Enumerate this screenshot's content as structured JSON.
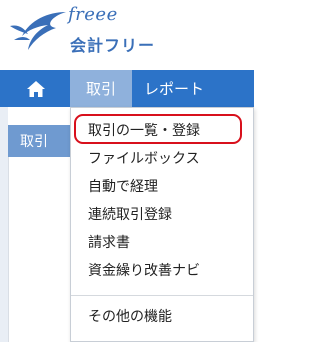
{
  "logo": {
    "brand": "freee",
    "product": "会計フリー"
  },
  "nav": {
    "home_icon": "home-icon",
    "tabs": [
      {
        "label": "取引",
        "active": true
      },
      {
        "label": "レポート",
        "active": false
      }
    ]
  },
  "page": {
    "sub_header_label": "取引"
  },
  "dropdown": {
    "items": [
      {
        "label": "取引の一覧・登録",
        "highlighted": true
      },
      {
        "label": "ファイルボックス"
      },
      {
        "label": "自動で経理"
      },
      {
        "label": "連続取引登録"
      },
      {
        "label": "請求書"
      },
      {
        "label": "資金繰り改善ナビ"
      }
    ],
    "footer_item": "その他の機能"
  },
  "colors": {
    "navbar": "#2c73c8",
    "active_tab": "#8fb1dc",
    "brand": "#3a6fb8",
    "highlight": "#d8101c"
  }
}
